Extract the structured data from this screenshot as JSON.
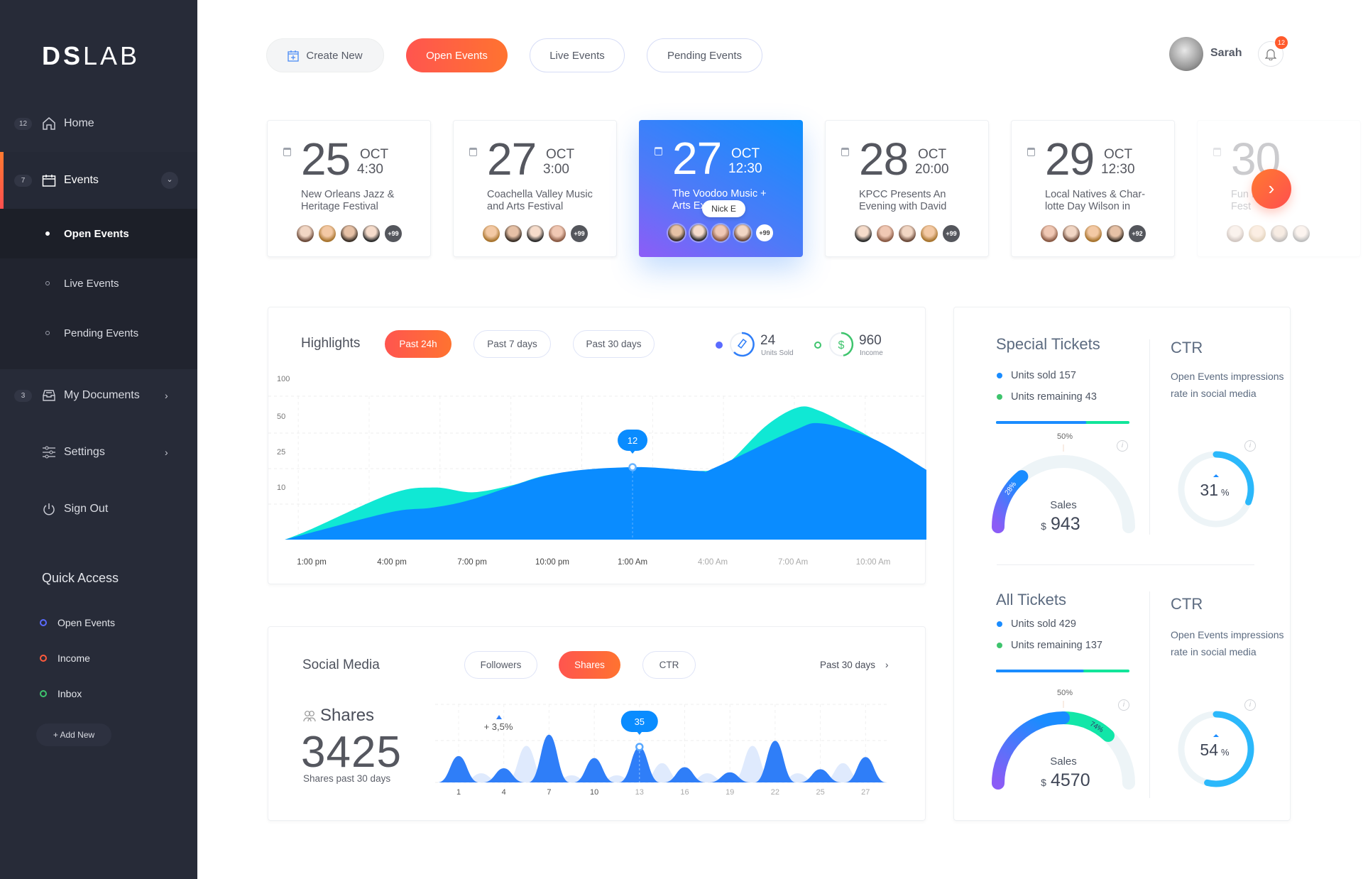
{
  "sidebar": {
    "logo_bold": "DS",
    "logo_light": "LAB",
    "home": {
      "badge": "12",
      "label": "Home"
    },
    "events": {
      "badge": "7",
      "label": "Events"
    },
    "submenu": [
      {
        "label": "Open Events",
        "active": true
      },
      {
        "label": "Live Events",
        "active": false
      },
      {
        "label": "Pending Events",
        "active": false
      }
    ],
    "documents": {
      "badge": "3",
      "label": "My Documents"
    },
    "settings": {
      "label": "Settings"
    },
    "sign_out": {
      "label": "Sign Out"
    },
    "quick_access": {
      "title": "Quick Access",
      "items": [
        {
          "label": "Open Events",
          "color": "#5a6bff"
        },
        {
          "label": "Income",
          "color": "#ff5a3c"
        },
        {
          "label": "Inbox",
          "color": "#3ec46d"
        }
      ],
      "add_new": "+  Add New"
    }
  },
  "toolbar": {
    "create_new": "Create New",
    "tabs": [
      "Open Events",
      "Live Events",
      "Pending Events"
    ],
    "user_name": "Sarah",
    "notification_count": "12"
  },
  "events": [
    {
      "day": "25",
      "month": "OCT",
      "time": "4:30",
      "title": [
        "New Orleans Jazz &",
        "Heritage Festival"
      ],
      "more": "+99"
    },
    {
      "day": "27",
      "month": "OCT",
      "time": "3:00",
      "title": [
        "Coachella Valley Music",
        "and Arts Festival"
      ],
      "more": "+99"
    },
    {
      "day": "27",
      "month": "OCT",
      "time": "12:30",
      "title": [
        "The Voodoo Music +",
        "Arts Ex"
      ],
      "more": "+99",
      "active": true,
      "tooltip": "Nick E"
    },
    {
      "day": "28",
      "month": "OCT",
      "time": "20:00",
      "title": [
        "KPCC Presents An",
        "Evening with David"
      ],
      "more": "+99"
    },
    {
      "day": "29",
      "month": "OCT",
      "time": "12:30",
      "title": [
        "Local Natives & Char-",
        "lotte Day Wilson in"
      ],
      "more": "+92"
    },
    {
      "day": "30",
      "month": "",
      "time": "",
      "title": [
        "Fun F",
        "Fest"
      ],
      "more": "",
      "faded": true
    }
  ],
  "highlights": {
    "title": "Highlights",
    "filters": [
      "Past 24h",
      "Past 7 days",
      "Past 30 days"
    ],
    "active_filter": 0,
    "units_sold": {
      "value": "24",
      "label": "Units Sold",
      "color": "#5a6bff"
    },
    "income": {
      "value": "960",
      "label": "Income",
      "color": "#3ec46d"
    }
  },
  "social": {
    "title": "Social Media",
    "filters": [
      "Followers",
      "Shares",
      "CTR"
    ],
    "active_filter": 1,
    "period": "Past 30 days",
    "metric_label": "Shares",
    "metric_value": "3425",
    "metric_caption": "Shares past 30 days",
    "change": "+ 3,5%"
  },
  "special_tickets": {
    "title": "Special Tickets",
    "sold": "Units sold 157",
    "remaining": "Units remaining 43",
    "progress_fraction": 0.67,
    "gauge_marker": "50%",
    "gauge_percent": 28,
    "gauge_label": "28%",
    "sales_label": "Sales",
    "currency": "$",
    "sales_value": "943",
    "ctr_title": "CTR",
    "ctr_desc": "Open Events impressions rate in social media",
    "ctr_value": "31",
    "ctr_percent": 31,
    "ctr_unit": "%"
  },
  "all_tickets": {
    "title": "All Tickets",
    "sold": "Units sold 429",
    "remaining": "Units remaining 137",
    "progress_fraction": 0.65,
    "gauge_marker": "50%",
    "gauge_percent": 74,
    "gauge_label": "74%",
    "sales_label": "Sales",
    "currency": "$",
    "sales_value": "4570",
    "ctr_title": "CTR",
    "ctr_desc": "Open Events impressions rate in social media",
    "ctr_value": "54",
    "ctr_percent": 54,
    "ctr_unit": "%"
  },
  "chart_data": [
    {
      "type": "area",
      "title": "Highlights",
      "x_unit": "hours from 1:00 pm",
      "xlim": [
        -1,
        23
      ],
      "x_ticks": [
        0,
        3,
        6,
        9,
        12,
        15,
        18,
        21
      ],
      "x_tick_labels": [
        "1:00 pm",
        "4:00 pm",
        "7:00 pm",
        "10:00 pm",
        "1:00 Am",
        "4:00 Am",
        "7:00 Am",
        "10:00 Am"
      ],
      "y_ticks": [
        100,
        50,
        25,
        10
      ],
      "ylim": [
        0,
        100
      ],
      "grid": true,
      "series": [
        {
          "name": "secondary",
          "color": "#10e8d4",
          "x": [
            -1,
            0,
            3,
            4.6,
            6,
            7.5,
            9,
            12,
            14.5,
            15.5,
            17,
            18.2,
            19,
            20,
            21,
            23
          ],
          "y": [
            0,
            3,
            14.5,
            17,
            15,
            18,
            22.6,
            26,
            24,
            28,
            60,
            85,
            80,
            62,
            46,
            24
          ]
        },
        {
          "name": "primary",
          "color": "#0a8cff",
          "x": [
            -1,
            0,
            3,
            4.5,
            6,
            9,
            12,
            14.5,
            15,
            18,
            19.1,
            21,
            23
          ],
          "y": [
            0,
            2,
            7.8,
            9,
            12,
            22.6,
            26,
            24,
            25,
            53,
            63,
            46,
            24.4
          ]
        }
      ],
      "annotation": {
        "x": 12,
        "series": "primary",
        "label": "12"
      }
    },
    {
      "type": "area",
      "title": "Shares",
      "x_tick_labels": [
        "1",
        "4",
        "7",
        "10",
        "13",
        "16",
        "19",
        "22",
        "25",
        "27"
      ],
      "x_ticks": [
        1,
        4,
        7,
        10,
        13,
        16,
        19,
        22,
        25,
        27
      ],
      "series": [
        {
          "name": "previous",
          "color": "#dfeafd",
          "x": [
            2.5,
            5.5,
            8.5,
            11.5,
            14.5,
            17.5,
            20.5,
            23.5,
            26
          ],
          "y": [
            9,
            36,
            7,
            7,
            19,
            9,
            36,
            9,
            19
          ]
        },
        {
          "name": "shares",
          "color": "#2f7ef8",
          "x": [
            1,
            4,
            7,
            10,
            13,
            16,
            19,
            22,
            25,
            27
          ],
          "y": [
            26,
            14,
            47,
            24,
            35,
            15,
            10,
            41,
            13,
            25
          ]
        }
      ],
      "annotation": {
        "x": 13,
        "label": "35"
      }
    }
  ]
}
